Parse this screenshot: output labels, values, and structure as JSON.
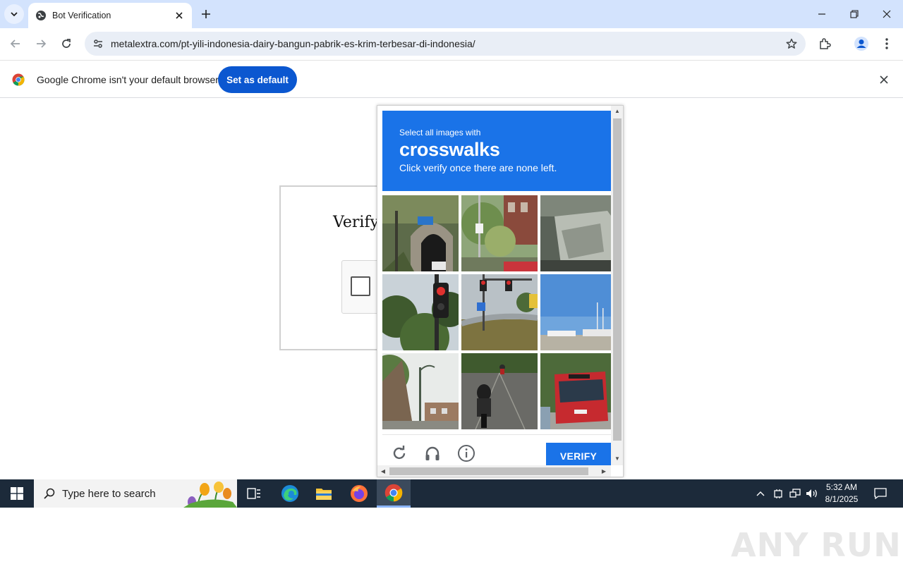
{
  "browser": {
    "tab": {
      "title": "Bot Verification",
      "favicon": "globe-icon"
    },
    "url": "metalextra.com/pt-yili-indonesia-dairy-bangun-pabrik-es-krim-terbesar-di-indonesia/",
    "infobar": {
      "message": "Google Chrome isn't your default browser",
      "button_label": "Set as default"
    }
  },
  "page": {
    "verify_title": "Verify"
  },
  "captcha": {
    "instruction": "Select all images with",
    "target": "crosswalks",
    "subtext": "Click verify once there are none left.",
    "verify_label": "VERIFY",
    "tiles": [
      "tunnel-road",
      "street-sign-trees",
      "garbage-truck",
      "traffic-light-trees",
      "traffic-light-highway",
      "harbor-boats",
      "streetlamp-building",
      "motorcycle-road",
      "red-bus"
    ],
    "footer_icons": [
      "reload-icon",
      "audio-headphones-icon",
      "info-icon"
    ],
    "accent_color": "#1a73e8"
  },
  "watermark": "ANY RUN",
  "taskbar": {
    "search_placeholder": "Type here to search",
    "time": "5:32 AM",
    "date": "8/1/2025",
    "apps": [
      "task-view-icon",
      "edge-icon",
      "file-explorer-icon",
      "firefox-icon",
      "chrome-icon"
    ]
  }
}
